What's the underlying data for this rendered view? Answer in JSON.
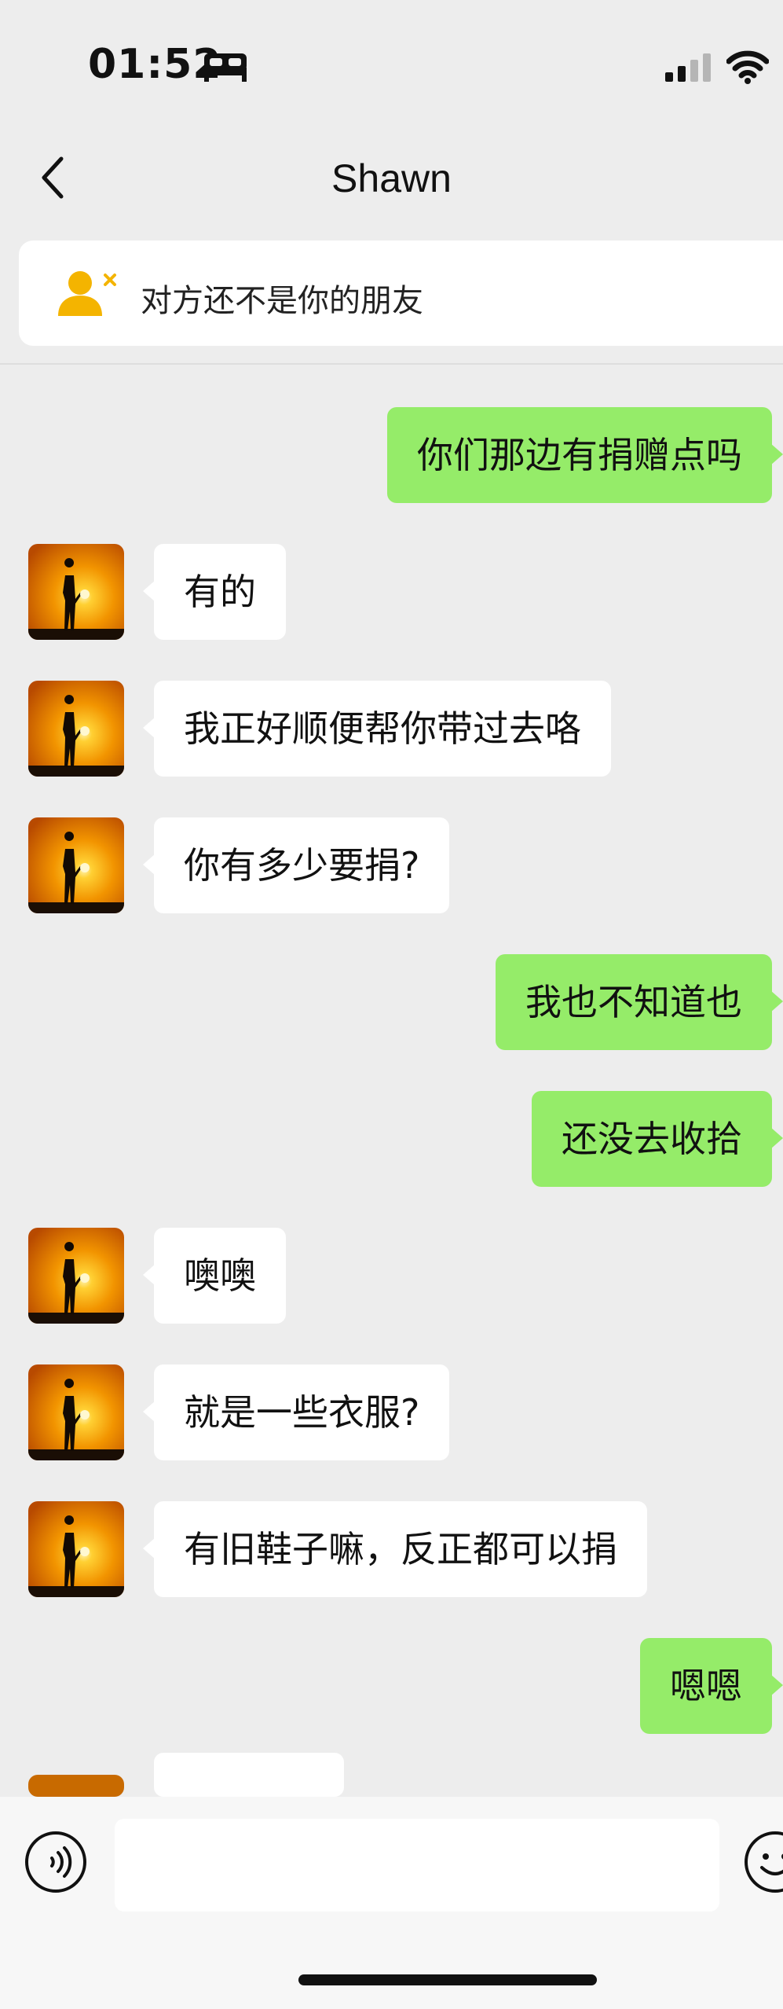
{
  "status_bar": {
    "time": "01:52",
    "icons": [
      "bed-icon",
      "signal-icon",
      "wifi-icon"
    ]
  },
  "nav": {
    "back_icon": "chevron-left-icon",
    "title": "Shawn"
  },
  "banner": {
    "icon": "not-friend-icon",
    "text": "对方还不是你的朋友"
  },
  "colors": {
    "background": "#ededed",
    "sent_bubble": "#95ec69",
    "received_bubble": "#ffffff",
    "banner_icon": "#f4b400"
  },
  "messages": [
    {
      "side": "right",
      "text": "你们那边有捐赠点吗"
    },
    {
      "side": "left",
      "text": "有的"
    },
    {
      "side": "left",
      "text": "我正好顺便帮你带过去咯"
    },
    {
      "side": "left",
      "text": "你有多少要捐?"
    },
    {
      "side": "right",
      "text": "我也不知道也"
    },
    {
      "side": "right",
      "text": "还没去收拾"
    },
    {
      "side": "left",
      "text": "噢噢"
    },
    {
      "side": "left",
      "text": "就是一些衣服?"
    },
    {
      "side": "left",
      "text": "有旧鞋子嘛，反正都可以捐"
    },
    {
      "side": "right",
      "text": "嗯嗯"
    }
  ],
  "input_bar": {
    "voice_icon": "voice-icon",
    "input_value": "",
    "emoji_icon": "emoji-icon"
  }
}
